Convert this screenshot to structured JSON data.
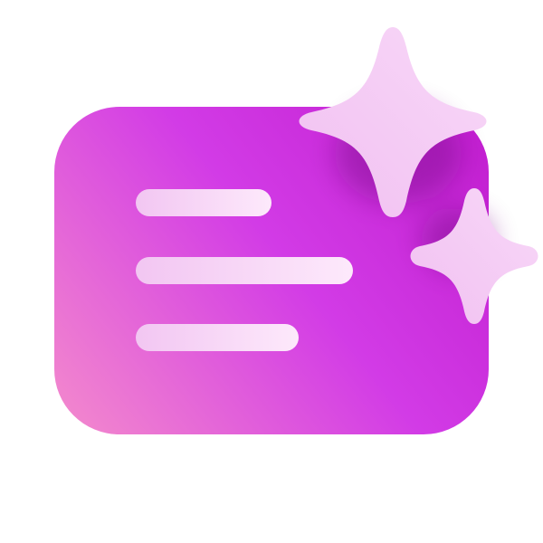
{
  "icon": {
    "name": "ai-summary-document-icon",
    "colors": {
      "card_top": "#c21fd0",
      "card_mid": "#d23be6",
      "card_bottom": "#f48bcc",
      "line_start": "#f2c6f2",
      "line_end": "#fde9fb",
      "sparkle": "#f1c0f1",
      "sparkle_light": "#f8d8f8"
    }
  }
}
